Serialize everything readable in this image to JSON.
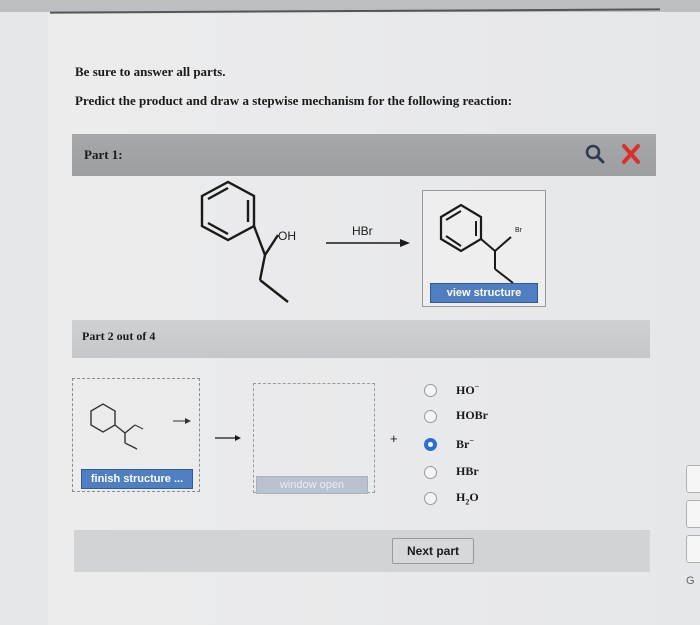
{
  "instructions": {
    "line1": "Be sure to answer all parts.",
    "line2": "Predict the product and draw a stepwise mechanism for the following reaction:"
  },
  "part1": {
    "label": "Part 1:",
    "icons": [
      "zoom-icon",
      "close-icon"
    ],
    "reactant_group": "OH",
    "reagent": "HBr",
    "product_substituent": "Br",
    "view_button": "view structure"
  },
  "part2": {
    "label": "Part 2 out of 4",
    "finish_button": "finish structure ...",
    "window_button": "window open",
    "plus": "+",
    "options": [
      {
        "base": "HO",
        "sup": "−",
        "sub": "",
        "selected": false
      },
      {
        "base": "HOBr",
        "sup": "",
        "sub": "",
        "selected": false
      },
      {
        "base": "Br",
        "sup": "−",
        "sub": "",
        "selected": true
      },
      {
        "base": "HBr",
        "sup": "",
        "sub": "",
        "selected": false
      },
      {
        "base": "H",
        "sub": "2",
        "tail": "O",
        "sup": "",
        "selected": false
      }
    ]
  },
  "footer": {
    "next_button": "Next part"
  },
  "side": {
    "letter": "G"
  },
  "colors": {
    "accent": "#4f7fc0",
    "close_red": "#d9312a",
    "radio_on": "#2d6fd0"
  }
}
